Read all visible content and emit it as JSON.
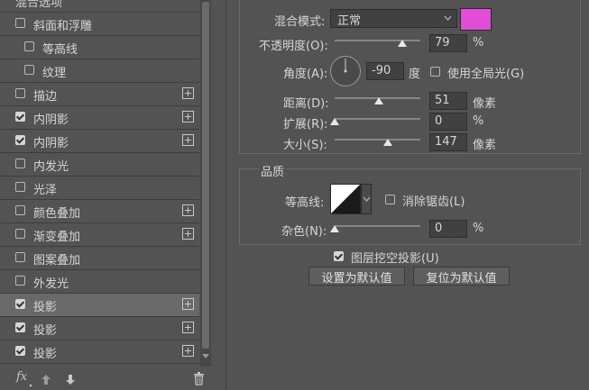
{
  "styles_panel": {
    "header": "混合选项",
    "items": [
      {
        "label": "斜面和浮雕",
        "checked": false,
        "has_add": false
      },
      {
        "label": "等高线",
        "checked": false,
        "has_add": false
      },
      {
        "label": "纹理",
        "checked": false,
        "has_add": false
      },
      {
        "label": "描边",
        "checked": false,
        "has_add": true
      },
      {
        "label": "内阴影",
        "checked": true,
        "has_add": true
      },
      {
        "label": "内阴影",
        "checked": true,
        "has_add": true
      },
      {
        "label": "内发光",
        "checked": false,
        "has_add": false
      },
      {
        "label": "光泽",
        "checked": false,
        "has_add": false
      },
      {
        "label": "颜色叠加",
        "checked": false,
        "has_add": true
      },
      {
        "label": "渐变叠加",
        "checked": false,
        "has_add": true
      },
      {
        "label": "图案叠加",
        "checked": false,
        "has_add": false
      },
      {
        "label": "外发光",
        "checked": false,
        "has_add": false
      },
      {
        "label": "投影",
        "checked": true,
        "has_add": true,
        "selected": true
      },
      {
        "label": "投影",
        "checked": true,
        "has_add": true
      },
      {
        "label": "投影",
        "checked": true,
        "has_add": true
      }
    ],
    "footer": {
      "fx": "fx"
    }
  },
  "structure": {
    "blend_mode_label": "混合模式:",
    "blend_mode_value": "正常",
    "color_swatch": "#e04ed8",
    "opacity_label": "不透明度(O):",
    "opacity_value": "79",
    "opacity_unit": "%",
    "angle_label": "角度(A):",
    "angle_value": "-90",
    "angle_unit": "度",
    "global_light_label": "使用全局光(G)",
    "global_light_checked": false,
    "distance_label": "距离(D):",
    "distance_value": "51",
    "distance_unit": "像素",
    "spread_label": "扩展(R):",
    "spread_value": "0",
    "spread_unit": "%",
    "size_label": "大小(S):",
    "size_value": "147",
    "size_unit": "像素"
  },
  "quality": {
    "title": "品质",
    "contour_label": "等高线:",
    "antialias_label": "消除锯齿(L)",
    "antialias_checked": false,
    "noise_label": "杂色(N):",
    "noise_value": "0",
    "noise_unit": "%"
  },
  "knockout": {
    "label": "图层挖空投影(U)",
    "checked": true
  },
  "buttons": {
    "make_default": "设置为默认值",
    "reset_default": "复位为默认值"
  }
}
